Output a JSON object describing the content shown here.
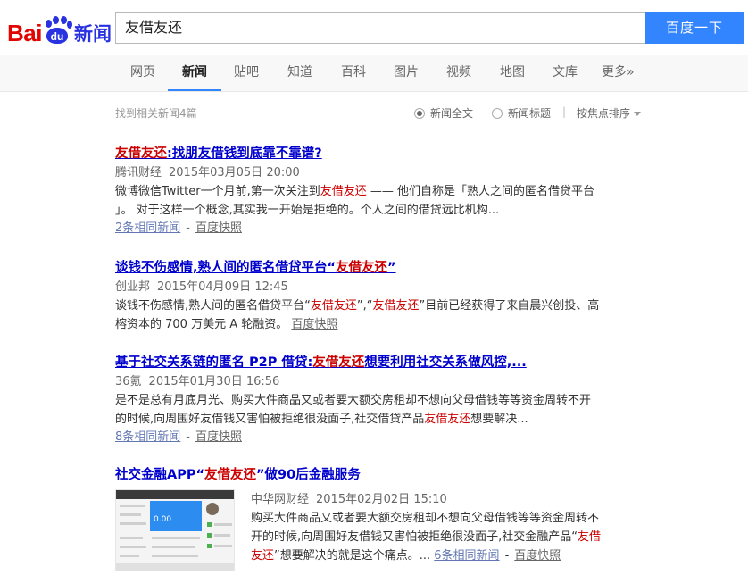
{
  "header": {
    "logo_left": "Bai",
    "logo_paw": "du",
    "logo_right": "新闻",
    "search_value": "友借友还",
    "search_button": "百度一下"
  },
  "nav": {
    "items": [
      "网页",
      "新闻",
      "贴吧",
      "知道",
      "百科",
      "图片",
      "视频",
      "地图",
      "文库",
      "更多»"
    ],
    "active": "新闻"
  },
  "toolbar": {
    "result_count": "找到相关新闻4篇",
    "option_fulltext": "新闻全文",
    "option_title": "新闻标题",
    "separator": "|",
    "sort_label": "按焦点排序"
  },
  "results": [
    {
      "title_em": "友借友还",
      "title_rest": ":找朋友借钱到底靠不靠谱?",
      "source": "腾讯财经",
      "time": "2015年03月05日 20:00",
      "abs_line1_a": "微博微信Twitter一个月前,第一次关注到",
      "abs_line1_em": "友借友还",
      "abs_line1_b": " —— 他们自称是「熟人之间的匿名借贷平台",
      "abs_line2": "」。 对于这样一个概念,其实我一开始是拒绝的。个人之间的借贷远比机构...",
      "related": "2条相同新闻",
      "dash": "-",
      "snapshot": "百度快照"
    },
    {
      "title_a": "谈钱不伤感情,熟人间的匿名借贷平台“",
      "title_em": "友借友还",
      "title_b": "”",
      "source": "创业邦",
      "time": "2015年04月09日 12:45",
      "abs_line1_a": "谈钱不伤感情,熟人间的匿名借贷平台“",
      "abs_line1_em1": "友借友还",
      "abs_line1_mid": "”,“",
      "abs_line1_em2": "友借友还",
      "abs_line1_b": "”目前已经获得了来自晨兴创投、高",
      "abs_line2": "榕资本的 700 万美元 A 轮融资。",
      "snapshot": "百度快照"
    },
    {
      "title_a": "基于社交关系链的匿名 P2P 借贷:",
      "title_em": "友借友还",
      "title_b": "想要利用社交关系做风控,...",
      "source": "36氪",
      "time": "2015年01月30日 16:56",
      "abs_line1": "是不是总有月底月光、购买大件商品又或者要大额交房租却不想向父母借钱等等资金周转不开",
      "abs_line2_a": "的时候,向周围好友借钱又害怕被拒绝很没面子,社交借贷产品",
      "abs_line2_em": "友借友还",
      "abs_line2_b": "想要解决...",
      "related": "8条相同新闻",
      "dash": "-",
      "snapshot": "百度快照"
    },
    {
      "title_a": "社交金融APP“",
      "title_em": "友借友还",
      "title_b": "”做90后金融服务",
      "source": "中华网财经",
      "time": "2015年02月02日 15:10",
      "abs_line1": "购买大件商品又或者要大额交房租却不想向父母借钱等等资金周转不",
      "abs_line2_a": "开的时候,向周围好友借钱又害怕被拒绝很没面子,社交金融产品“",
      "abs_line2_em": "友借",
      "abs_line3_em": "友还",
      "abs_line3_b": "”想要解决的就是这个痛点。... ",
      "related": "6条相同新闻",
      "dash": "-",
      "snapshot": "百度快照",
      "thumb_value": "0.00"
    }
  ],
  "colors": {
    "brand_red": "#e10602",
    "brand_blue": "#2932e1",
    "search_button": "#3385ff",
    "link": "#0000cc",
    "highlight": "#cc0000"
  }
}
